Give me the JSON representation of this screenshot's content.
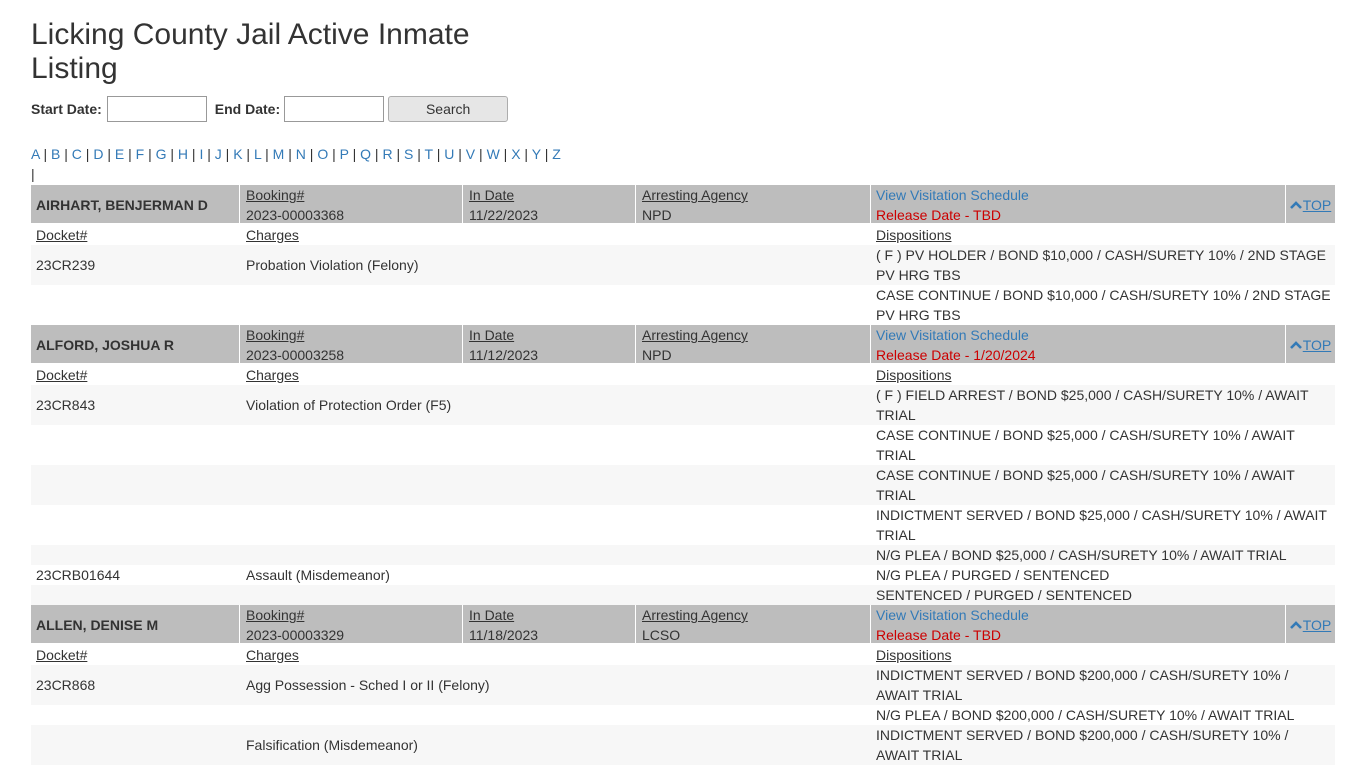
{
  "page": {
    "title": "Licking County Jail Active Inmate Listing"
  },
  "search": {
    "start_label": "Start Date:",
    "end_label": "End Date:",
    "start_value": "",
    "end_value": "",
    "button": "Search"
  },
  "letters": [
    "A",
    "B",
    "C",
    "D",
    "E",
    "F",
    "G",
    "H",
    "I",
    "J",
    "K",
    "L",
    "M",
    "N",
    "O",
    "P",
    "Q",
    "R",
    "S",
    "T",
    "U",
    "V",
    "W",
    "X",
    "Y",
    "Z"
  ],
  "labels": {
    "booking": "Booking#",
    "in_date": "In Date",
    "agency": "Arresting Agency",
    "visit": "View Visitation Schedule",
    "top": "TOP",
    "docket": "Docket#",
    "charges": "Charges",
    "dispositions": "Dispositions"
  },
  "inmates": [
    {
      "name": "AIRHART, BENJERMAN D",
      "booking": "2023-00003368",
      "in_date": "11/22/2023",
      "agency": "NPD",
      "release": "Release Date - TBD",
      "rows": [
        {
          "docket": "23CR239",
          "charge": "Probation Violation (Felony)",
          "disposition": "( F ) PV HOLDER / BOND $10,000 / CASH/SURETY 10% / 2ND STAGE PV HRG TBS"
        },
        {
          "docket": "",
          "charge": "",
          "disposition": "CASE CONTINUE / BOND $10,000 / CASH/SURETY 10% / 2ND STAGE PV HRG TBS"
        }
      ]
    },
    {
      "name": "ALFORD, JOSHUA R",
      "booking": "2023-00003258",
      "in_date": "11/12/2023",
      "agency": "NPD",
      "release": "Release Date - 1/20/2024",
      "rows": [
        {
          "docket": "23CR843",
          "charge": "Violation of Protection Order (F5)",
          "disposition": "( F ) FIELD ARREST / BOND $25,000 / CASH/SURETY 10% / AWAIT TRIAL"
        },
        {
          "docket": "",
          "charge": "",
          "disposition": "CASE CONTINUE / BOND $25,000 / CASH/SURETY 10% / AWAIT TRIAL"
        },
        {
          "docket": "",
          "charge": "",
          "disposition": "CASE CONTINUE / BOND $25,000 / CASH/SURETY 10% / AWAIT TRIAL"
        },
        {
          "docket": "",
          "charge": "",
          "disposition": "INDICTMENT SERVED / BOND $25,000 / CASH/SURETY 10% / AWAIT TRIAL"
        },
        {
          "docket": "",
          "charge": "",
          "disposition": "N/G PLEA / BOND $25,000 / CASH/SURETY 10% / AWAIT TRIAL"
        },
        {
          "docket": "23CRB01644",
          "charge": "Assault (Misdemeanor)",
          "disposition": "N/G PLEA / PURGED / SENTENCED"
        },
        {
          "docket": "",
          "charge": "",
          "disposition": "SENTENCED / PURGED / SENTENCED"
        }
      ]
    },
    {
      "name": "ALLEN, DENISE M",
      "booking": "2023-00003329",
      "in_date": "11/18/2023",
      "agency": "LCSO",
      "release": "Release Date - TBD",
      "rows": [
        {
          "docket": "23CR868",
          "charge": "Agg Possession - Sched I or II (Felony)",
          "disposition": "INDICTMENT SERVED / BOND $200,000 / CASH/SURETY 10% / AWAIT TRIAL"
        },
        {
          "docket": "",
          "charge": "",
          "disposition": "N/G PLEA / BOND $200,000 / CASH/SURETY 10% / AWAIT TRIAL"
        },
        {
          "docket": "",
          "charge": "Falsification (Misdemeanor)",
          "disposition": "INDICTMENT SERVED / BOND $200,000 / CASH/SURETY 10% / AWAIT TRIAL"
        }
      ]
    }
  ]
}
